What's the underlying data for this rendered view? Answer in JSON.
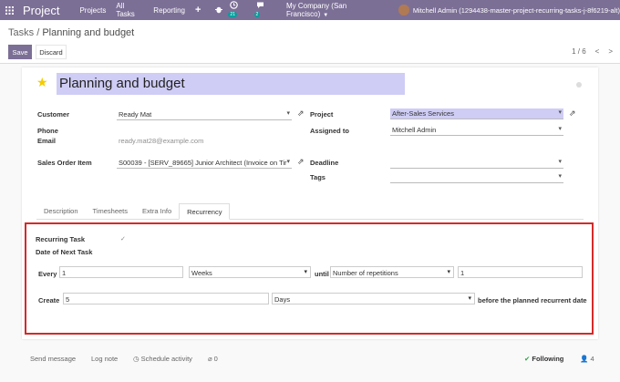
{
  "navbar": {
    "apps_icon": "grid-icon",
    "brand": "Project",
    "menu": [
      "Projects",
      "All Tasks",
      "Reporting"
    ],
    "plus": "+",
    "badge_activity": "21",
    "badge_messages": "2",
    "company": "My Company (San Francisco)",
    "user": "Mitchell Admin (1294438-master-project-recurring-tasks-j-8f6219-alt)"
  },
  "control": {
    "breadcrumb_parent": "Tasks",
    "breadcrumb_sep": "/",
    "breadcrumb_current": "Planning and budget",
    "save": "Save",
    "discard": "Discard",
    "pager": "1 / 6",
    "prev": "<",
    "next": ">"
  },
  "form": {
    "title": "Planning and budget",
    "customer_label": "Customer",
    "customer_value": "Ready Mat",
    "phone_label": "Phone",
    "email_label": "Email",
    "email_value": "ready.mat28@example.com",
    "sales_order_label": "Sales Order Item",
    "sales_order_value": "S00039 - [SERV_89665] Junior Architect (Invoice on Tir",
    "project_label": "Project",
    "project_value": "After-Sales Services",
    "assigned_label": "Assigned to",
    "assigned_value": "Mitchell Admin",
    "deadline_label": "Deadline",
    "deadline_value": "",
    "tags_label": "Tags",
    "tags_value": ""
  },
  "tabs": [
    "Description",
    "Timesheets",
    "Extra Info",
    "Recurrency"
  ],
  "recurrence": {
    "recurring_label": "Recurring Task",
    "next_date_label": "Date of Next Task",
    "check_mark": "✓",
    "every_label": "Every",
    "every_value": "1",
    "unit_value": "Weeks",
    "until_label": "until",
    "until_type": "Number of repetitions",
    "repetitions": "1",
    "create_label": "Create",
    "create_value": "5",
    "create_unit": "Days",
    "before_label": "before the planned recurrent date"
  },
  "chatter": {
    "send_message": "Send message",
    "log_note": "Log note",
    "schedule_activity": "Schedule activity",
    "attachments": "0",
    "following": "Following",
    "followers": "4"
  },
  "colors": {
    "navbar": "#7c6f96",
    "highlight": "#cfcdf5",
    "recurrence_border": "#d32a2a"
  }
}
